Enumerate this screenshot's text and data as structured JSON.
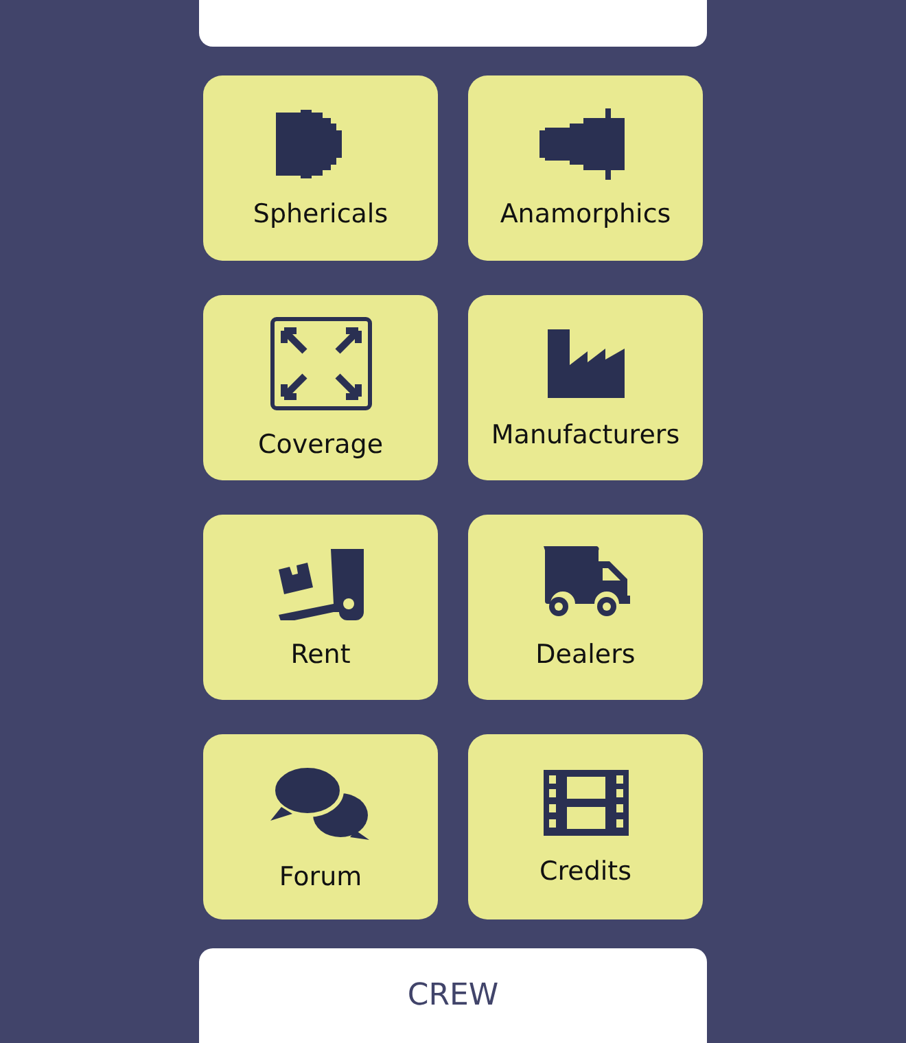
{
  "tiles": [
    {
      "label": "Sphericals",
      "kind": "spherical-lens"
    },
    {
      "label": "Anamorphics",
      "kind": "anamorphic-lens"
    },
    {
      "label": "Coverage",
      "kind": "coverage"
    },
    {
      "label": "Manufacturers",
      "kind": "factory"
    },
    {
      "label": "Rent",
      "kind": "forklift"
    },
    {
      "label": "Dealers",
      "kind": "truck"
    },
    {
      "label": "Forum",
      "kind": "chat"
    },
    {
      "label": "Credits",
      "kind": "film"
    }
  ],
  "crew_button": {
    "label": "CREW"
  }
}
